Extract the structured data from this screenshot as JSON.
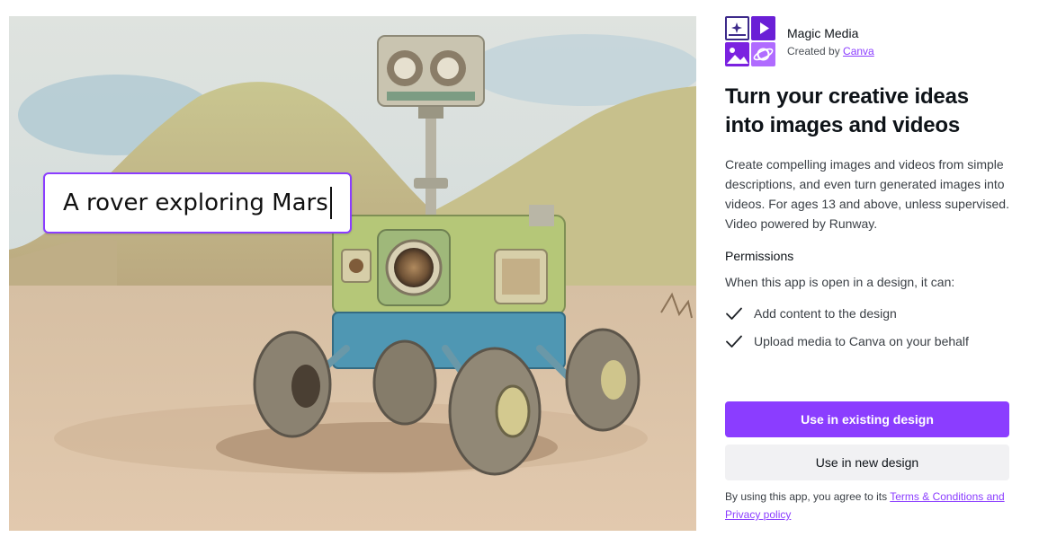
{
  "hero": {
    "prompt_text": "A rover exploring Mars"
  },
  "app": {
    "name": "Magic Media",
    "created_by_prefix": "Created by",
    "creator": "Canva",
    "icon": "magic-media-app-icon"
  },
  "headline": "Turn your creative ideas into images and videos",
  "description": "Create compelling images and videos from simple descriptions, and even turn generated images into videos. For ages 13 and above, unless supervised. Video powered by Runway.",
  "permissions": {
    "title": "Permissions",
    "lead": "When this app is open in a design, it can:",
    "items": [
      {
        "icon": "checkmark-icon",
        "label": "Add content to the design"
      },
      {
        "icon": "checkmark-icon",
        "label": "Upload media to Canva on your behalf"
      }
    ]
  },
  "actions": {
    "primary_label": "Use in existing design",
    "secondary_label": "Use in new design"
  },
  "legal": {
    "prefix": "By using this app, you agree to its",
    "link_label": "Terms & Conditions and Privacy policy"
  },
  "colors": {
    "accent": "#8b3dff",
    "secondary_button": "#f1f1f3",
    "text": "#0e1318"
  }
}
